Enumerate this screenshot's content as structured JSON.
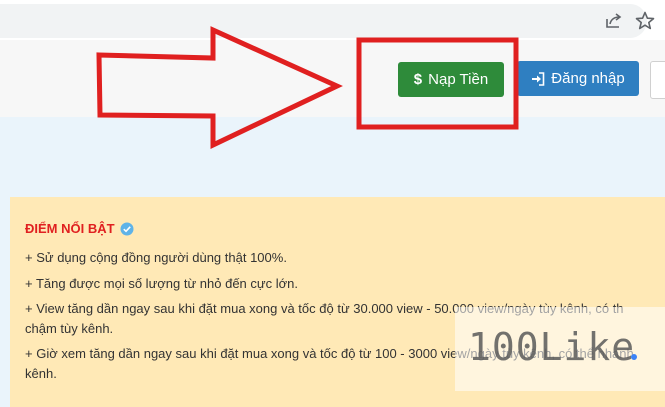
{
  "colors": {
    "annotation_red": "#e02020",
    "deposit_green": "#2e8b3a",
    "login_blue": "#2f7fc1",
    "panel_bg": "#ffe9b6"
  },
  "browser": {
    "share_icon": "share-icon",
    "star_icon": "star-icon"
  },
  "header": {
    "deposit_icon": "$",
    "deposit_label": "Nạp Tiền",
    "login_label": "Đăng nhập"
  },
  "highlights": {
    "title": "ĐIỂM NỔI BẬT",
    "lines": [
      "+ Sử dụng cộng đồng người dùng thật 100%.",
      "+ Tăng được mọi số lượng từ nhỏ đến cực lớn.",
      "+ View tăng dần ngay sau khi đặt mua xong và tốc độ từ 30.000 view - 50.000 view/ngày tùy kênh, có th",
      "chậm tùy kênh.",
      "+ Giờ xem tăng dần ngay sau khi đặt mua xong và tốc độ từ 100 - 3000 view/ngày tùy kênh, có thể nhanh",
      "kênh."
    ]
  },
  "watermark": {
    "text": "100Like"
  }
}
